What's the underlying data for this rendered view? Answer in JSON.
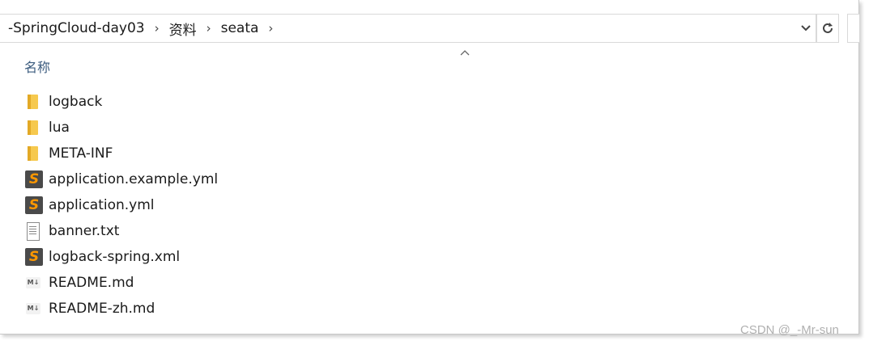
{
  "breadcrumb": {
    "items": [
      "-SpringCloud-day03",
      "资料",
      "seata"
    ],
    "separator": "›"
  },
  "toolbar": {
    "dropdown_icon": "chevron-down-icon",
    "refresh_icon": "refresh-icon"
  },
  "list": {
    "column_name_header": "名称",
    "files": [
      {
        "name": "logback",
        "type": "folder"
      },
      {
        "name": "lua",
        "type": "folder"
      },
      {
        "name": "META-INF",
        "type": "folder"
      },
      {
        "name": "application.example.yml",
        "type": "sublime"
      },
      {
        "name": "application.yml",
        "type": "sublime"
      },
      {
        "name": "banner.txt",
        "type": "text"
      },
      {
        "name": "logback-spring.xml",
        "type": "sublime"
      },
      {
        "name": "README.md",
        "type": "markdown"
      },
      {
        "name": "README-zh.md",
        "type": "markdown"
      }
    ]
  },
  "watermark": "CSDN @_-Mr-sun",
  "colors": {
    "folder": "#f6c94e",
    "sublime_bg": "#4a4a4a",
    "sublime_s": "#ff9800",
    "header_text": "#3b5b7e"
  }
}
